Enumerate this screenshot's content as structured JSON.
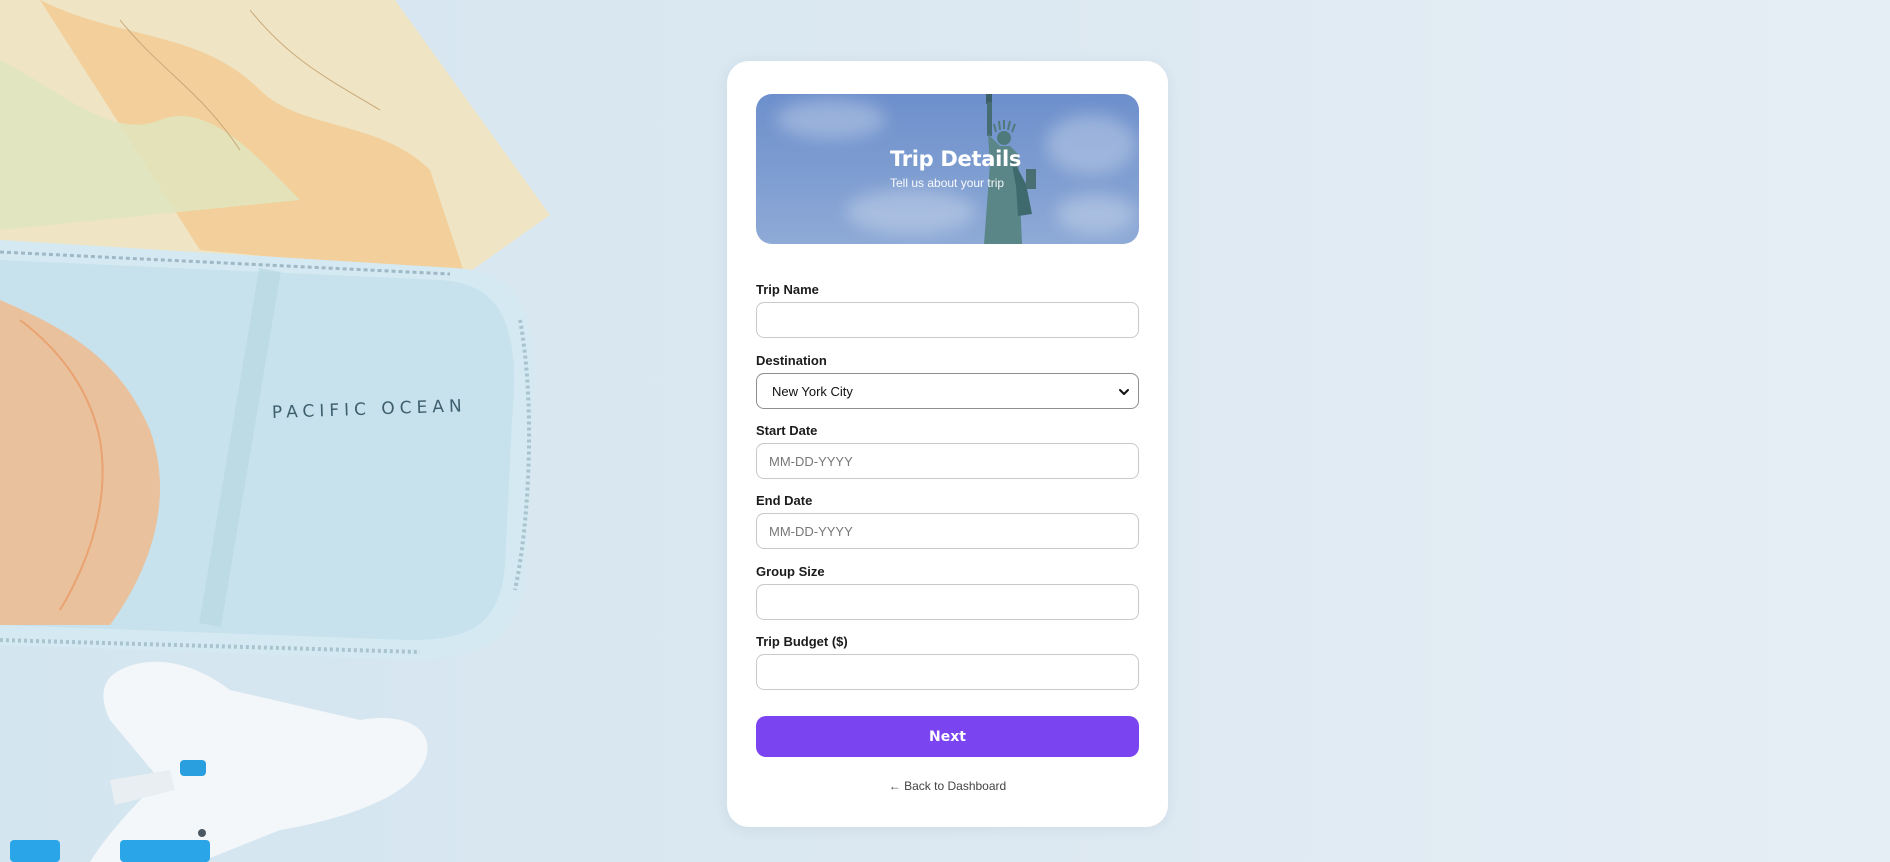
{
  "background": {
    "ocean_label": "PACIFIC OCEAN"
  },
  "hero": {
    "title": "Trip Details",
    "subtitle": "Tell us about your trip"
  },
  "form": {
    "trip_name": {
      "label": "Trip Name",
      "value": "",
      "placeholder": ""
    },
    "destination": {
      "label": "Destination",
      "selected": "New York City"
    },
    "start_date": {
      "label": "Start Date",
      "value": "",
      "placeholder": "MM-DD-YYYY"
    },
    "end_date": {
      "label": "End Date",
      "value": "",
      "placeholder": "MM-DD-YYYY"
    },
    "group_size": {
      "label": "Group Size",
      "value": "",
      "placeholder": ""
    },
    "trip_budget": {
      "label": "Trip Budget ($)",
      "value": "",
      "placeholder": ""
    }
  },
  "actions": {
    "next_label": "Next",
    "back_label": "← Back to Dashboard"
  },
  "colors": {
    "accent": "#7a44f0",
    "page_background": "#dbe8f1"
  },
  "icons": {
    "select_arrow": "chevron-down-icon"
  }
}
